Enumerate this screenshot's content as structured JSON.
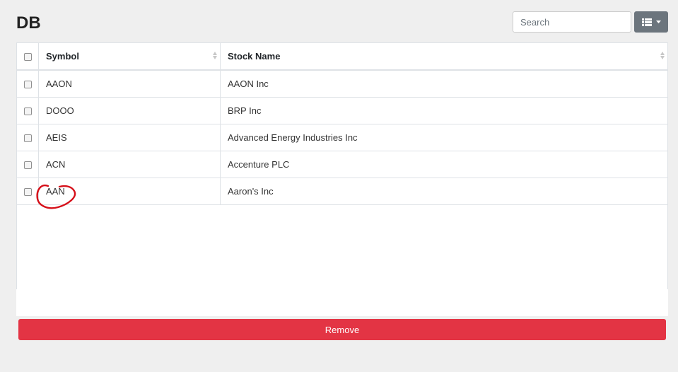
{
  "page": {
    "title": "DB"
  },
  "toolbar": {
    "search_placeholder": "Search",
    "columns_icon": "list-columns-icon",
    "dropdown_icon": "caret-down-icon"
  },
  "table": {
    "columns": [
      "Symbol",
      "Stock Name"
    ],
    "rows": [
      {
        "symbol": "AAON",
        "name": "AAON Inc"
      },
      {
        "symbol": "DOOO",
        "name": "BRP Inc"
      },
      {
        "symbol": "AEIS",
        "name": "Advanced Energy Industries Inc"
      },
      {
        "symbol": "ACN",
        "name": "Accenture PLC"
      },
      {
        "symbol": "AAN",
        "name": "Aaron's Inc"
      }
    ]
  },
  "actions": {
    "remove_label": "Remove"
  },
  "colors": {
    "danger": "#e33444",
    "secondary": "#6c757d",
    "annotation": "#d6101a"
  }
}
